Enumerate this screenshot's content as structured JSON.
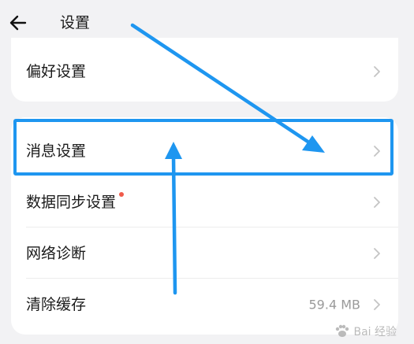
{
  "header": {
    "back_icon": "arrow-left-icon",
    "title": "设置"
  },
  "top_card": {
    "label": "偏好设置"
  },
  "main_card": {
    "rows": [
      {
        "label": "消息设置"
      },
      {
        "label": "数据同步设置",
        "has_badge": true
      },
      {
        "label": "网络诊断"
      },
      {
        "label": "清除缓存",
        "value": "59.4 MB"
      }
    ]
  },
  "annotation": {
    "color": "#1e96f0"
  },
  "watermark": {
    "text": "Bai 经验"
  }
}
